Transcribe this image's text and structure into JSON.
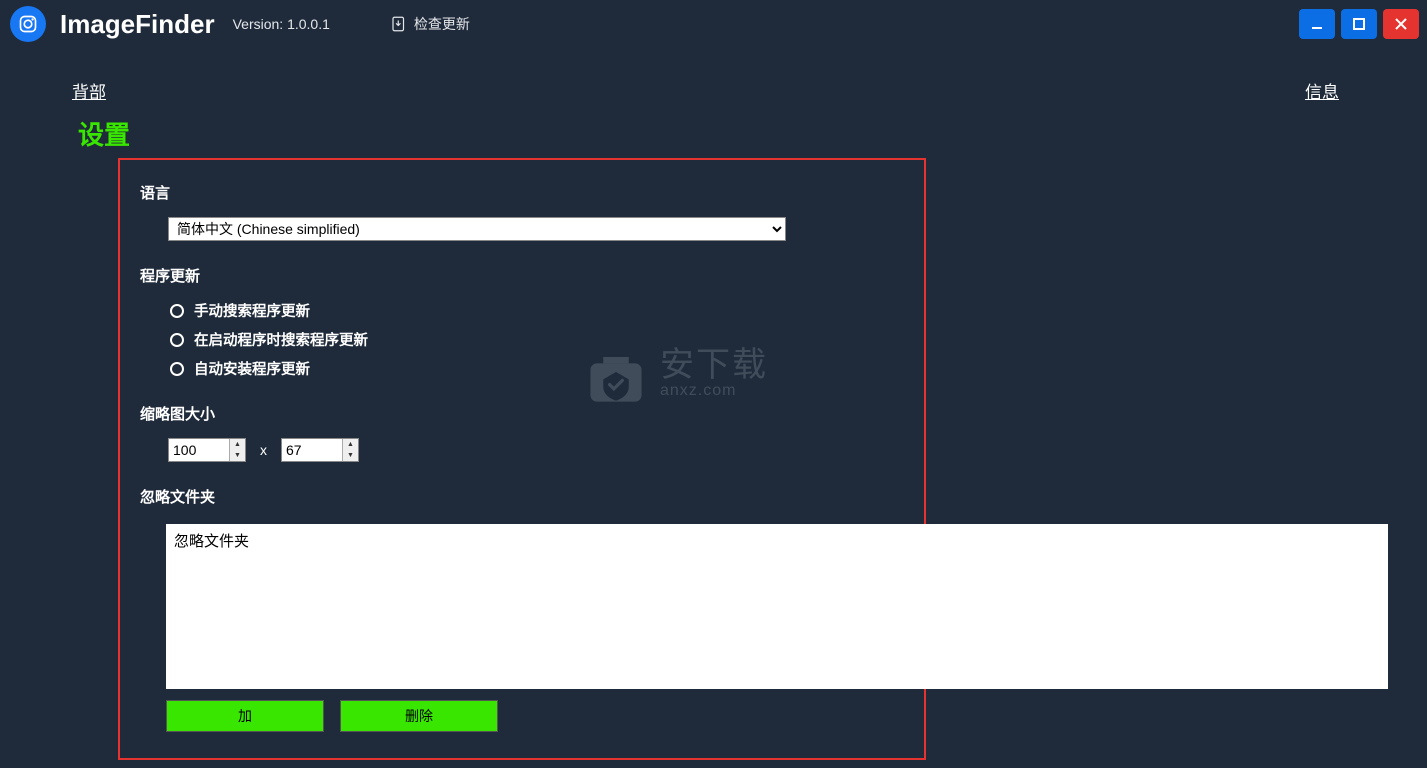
{
  "titlebar": {
    "appName": "ImageFinder",
    "version": "Version: 1.0.0.1",
    "checkUpdate": "检查更新"
  },
  "nav": {
    "back": "背部",
    "info": "信息"
  },
  "heading": "设置",
  "sections": {
    "language": {
      "label": "语言",
      "selected": "简体中文 (Chinese simplified)"
    },
    "update": {
      "label": "程序更新",
      "options": [
        {
          "label": "手动搜索程序更新",
          "checked": true
        },
        {
          "label": "在启动程序时搜索程序更新",
          "checked": false
        },
        {
          "label": "自动安装程序更新",
          "checked": false
        }
      ]
    },
    "thumb": {
      "label": "缩略图大小",
      "w": "100",
      "x": "x",
      "h": "67"
    },
    "ignore": {
      "label": "忽略文件夹",
      "content": "忽略文件夹"
    }
  },
  "buttons": {
    "add": "加",
    "delete": "删除"
  },
  "watermark": {
    "cn": "安下载",
    "en": "anxz.com"
  }
}
